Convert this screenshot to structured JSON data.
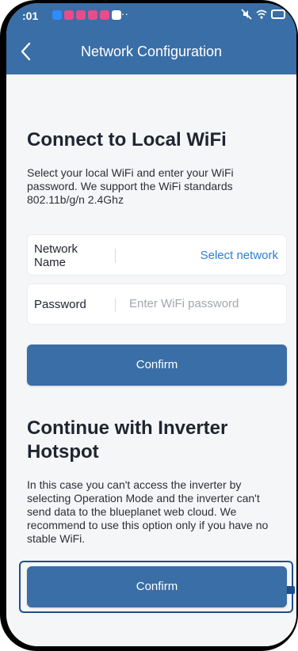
{
  "status_bar": {
    "time": ":01",
    "more": "···"
  },
  "header": {
    "title": "Network Configuration",
    "back_icon": "chevron-left-icon"
  },
  "wifi_section": {
    "title": "Connect to Local WiFi",
    "description": "Select your local WiFi and enter your WiFi password. We support the WiFi standards 802.11b/g/n 2.4Ghz",
    "network_label": "Network Name",
    "select_network": "Select network",
    "password_label": "Password",
    "password_placeholder": "Enter WiFi password",
    "confirm_label": "Confirm"
  },
  "hotspot_section": {
    "title": "Continue with Inverter Hotspot",
    "description": "In this case you can't access the inverter by selecting Operation Mode and the inverter can't send data to the blueplanet web cloud. We recommend to use this option only if you have no stable WiFi.",
    "confirm_label": "Confirm"
  },
  "colors": {
    "primary": "#3a6ea6",
    "link": "#2a7fd6",
    "background": "#f5f6f8"
  }
}
